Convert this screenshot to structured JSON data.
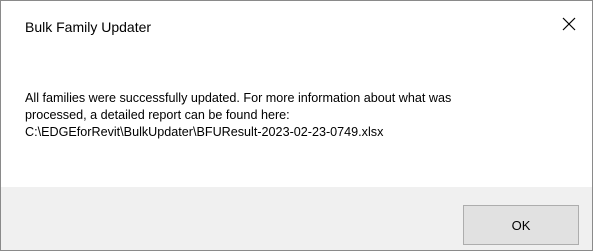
{
  "dialog": {
    "title": "Bulk Family Updater",
    "close_icon": "close-icon",
    "message_lines": [
      "All families were successfully updated. For more information about what was",
      "processed, a detailed report can be found here:",
      "C:\\EDGEforRevit\\BulkUpdater\\BFUResult-2023-02-23-0749.xlsx"
    ],
    "ok_label": "OK"
  },
  "colors": {
    "footer_background": "#f0f0f0",
    "button_background": "#e1e1e1",
    "button_border": "#adadad"
  }
}
